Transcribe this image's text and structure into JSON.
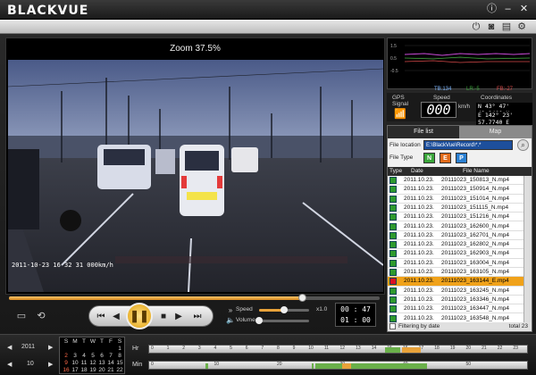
{
  "app": {
    "title": "BLACKVUE"
  },
  "colors": {
    "accent": "#e8a23a",
    "selected_row": "#f0a21a",
    "badge_n": "#3aa53a",
    "badge_e": "#e06a1a",
    "badge_p": "#2a7fd1"
  },
  "player": {
    "zoom_label": "Zoom 37.5%",
    "osd_text": "2011-10-23 16 32 31  000km/h",
    "speed_label": "Speed",
    "speed_value": "x1.0",
    "volume_label": "Volume",
    "time_current": "00 : 47",
    "time_total": "01 : 00",
    "seek_progress": 0.79,
    "speed_slider": 0.5,
    "volume_slider": 0.0
  },
  "gsensor": {
    "x_label": "TB:134",
    "y_label": "LR:-5",
    "z_label": "FB:-27",
    "y_ticks": [
      "1.5",
      "0.5",
      "-0.5"
    ]
  },
  "gps": {
    "title_line1": "GPS",
    "title_line2": "Signal",
    "speed_title": "Speed",
    "speed_value": "000",
    "speed_unit": "km/h",
    "coord_title": "Coordinates",
    "lat": "N 43° 47' 42.2400 N",
    "lon": "E 142° 23' 57.7740 E"
  },
  "files": {
    "tab_file": "File list",
    "tab_map": "Map",
    "location_label": "File location",
    "location_value": "E:\\BlackVue\\Record\\*.*",
    "type_label": "File Type",
    "types": [
      "N",
      "E",
      "P"
    ],
    "col_type": "Type",
    "col_date": "Date",
    "col_name": "File Name",
    "rows": [
      {
        "date": "2011.10.23.",
        "name": "20111023_150813_N.mp4"
      },
      {
        "date": "2011.10.23.",
        "name": "20111023_150914_N.mp4"
      },
      {
        "date": "2011.10.23.",
        "name": "20111023_151014_N.mp4"
      },
      {
        "date": "2011.10.23.",
        "name": "20111023_151115_N.mp4"
      },
      {
        "date": "2011.10.23.",
        "name": "20111023_151216_N.mp4"
      },
      {
        "date": "2011.10.23.",
        "name": "20111023_162600_N.mp4"
      },
      {
        "date": "2011.10.23.",
        "name": "20111023_162701_N.mp4"
      },
      {
        "date": "2011.10.23.",
        "name": "20111023_162802_N.mp4"
      },
      {
        "date": "2011.10.23.",
        "name": "20111023_162903_N.mp4"
      },
      {
        "date": "2011.10.23.",
        "name": "20111023_163004_N.mp4"
      },
      {
        "date": "2011.10.23.",
        "name": "20111023_163105_N.mp4"
      },
      {
        "date": "2011.10.23.",
        "name": "20111023_163144_E.mp4",
        "selected": true
      },
      {
        "date": "2011.10.23.",
        "name": "20111023_163245_N.mp4"
      },
      {
        "date": "2011.10.23.",
        "name": "20111023_163346_N.mp4"
      },
      {
        "date": "2011.10.23.",
        "name": "20111023_163447_N.mp4"
      },
      {
        "date": "2011.10.23.",
        "name": "20111023_163548_N.mp4"
      }
    ],
    "filter_label": "Filtering by date",
    "total_label": "total 23"
  },
  "calendar": {
    "year": "2011",
    "month": "10",
    "weekdays": [
      "S",
      "M",
      "T",
      "W",
      "T",
      "F",
      "S"
    ],
    "days": [
      "",
      "",
      "",
      "",
      "",
      "",
      "1",
      "2",
      "3",
      "4",
      "5",
      "6",
      "7",
      "8",
      "9",
      "10",
      "11",
      "12",
      "13",
      "14",
      "15",
      "16",
      "17",
      "18",
      "19",
      "20",
      "21",
      "22"
    ]
  },
  "timeline": {
    "hr_label": "Hr",
    "min_label": "Min",
    "hr_ticks": [
      "0",
      "1",
      "2",
      "3",
      "4",
      "5",
      "6",
      "7",
      "8",
      "9",
      "10",
      "11",
      "12",
      "13",
      "14",
      "15",
      "16",
      "17",
      "18",
      "19",
      "20",
      "21",
      "22",
      "23"
    ],
    "min_ticks": [
      "0",
      "10",
      "20",
      "30",
      "40",
      "50"
    ]
  }
}
